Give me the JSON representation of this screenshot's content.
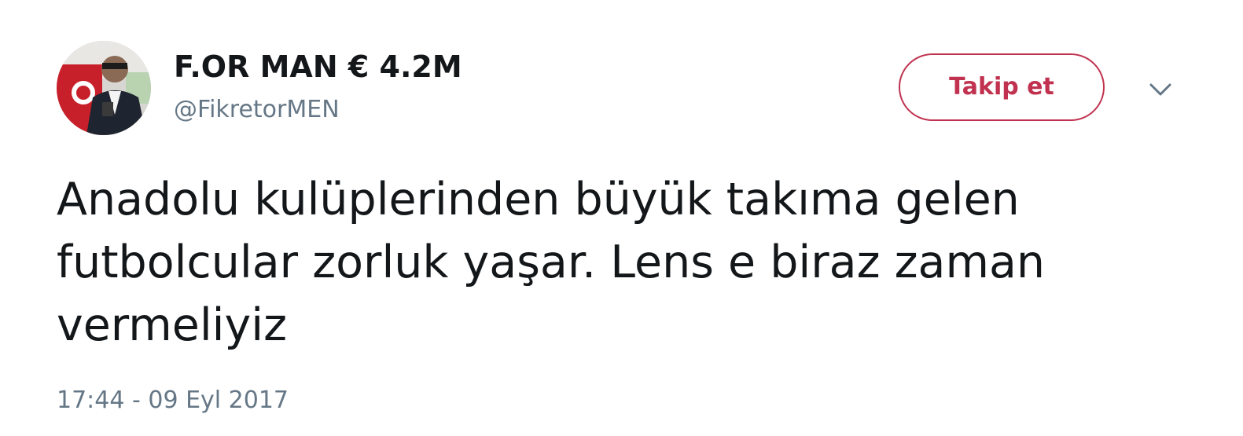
{
  "author": {
    "display_name": "F.OR MAN € 4.2M",
    "handle": "@FikretorMEN"
  },
  "actions": {
    "follow_label": "Takip et",
    "more_icon": "chevron-down-icon"
  },
  "tweet": {
    "lines": [
      "Anadolu kulüplerinden büyük takıma gelen",
      "futbolcular zorluk yaşar. Lens e biraz zaman",
      "vermeliyiz"
    ],
    "timestamp": "17:44 - 09 Eyl 2017"
  },
  "colors": {
    "accent": "#c0324f",
    "secondary_text": "#657786",
    "primary_text": "#14171a"
  }
}
